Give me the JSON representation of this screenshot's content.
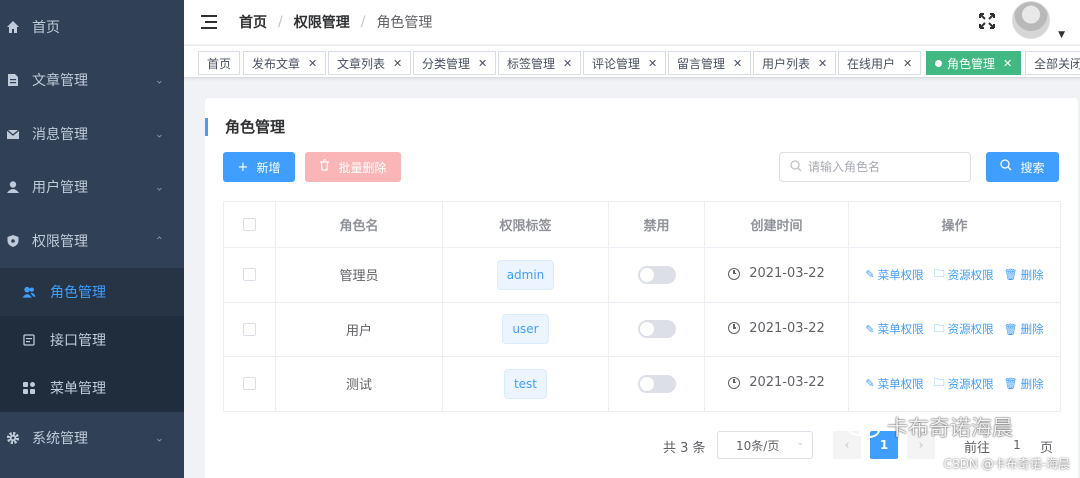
{
  "sidebar": {
    "items": [
      {
        "label": "首页",
        "icon": "home-icon",
        "expandable": false
      },
      {
        "label": "文章管理",
        "icon": "document-icon",
        "expandable": true
      },
      {
        "label": "消息管理",
        "icon": "mail-icon",
        "expandable": true
      },
      {
        "label": "用户管理",
        "icon": "user-icon",
        "expandable": true
      },
      {
        "label": "权限管理",
        "icon": "shield-icon",
        "expandable": true,
        "expanded": true
      },
      {
        "label": "系统管理",
        "icon": "gear-icon",
        "expandable": true
      }
    ],
    "submenu": [
      {
        "label": "角色管理",
        "icon": "users-icon",
        "active": true
      },
      {
        "label": "接口管理",
        "icon": "api-icon",
        "active": false
      },
      {
        "label": "菜单管理",
        "icon": "grid-icon",
        "active": false
      }
    ]
  },
  "header": {
    "breadcrumb": [
      "首页",
      "权限管理",
      "角色管理"
    ]
  },
  "tags": [
    {
      "label": "首页",
      "closable": false
    },
    {
      "label": "发布文章",
      "closable": true
    },
    {
      "label": "文章列表",
      "closable": true
    },
    {
      "label": "分类管理",
      "closable": true
    },
    {
      "label": "标签管理",
      "closable": true
    },
    {
      "label": "评论管理",
      "closable": true
    },
    {
      "label": "留言管理",
      "closable": true
    },
    {
      "label": "用户列表",
      "closable": true
    },
    {
      "label": "在线用户",
      "closable": true
    },
    {
      "label": "角色管理",
      "closable": true,
      "active": true
    },
    {
      "label": "全部关闭",
      "closable": false
    }
  ],
  "card": {
    "title": "角色管理",
    "add_label": "新增",
    "batch_delete_label": "批量删除",
    "search_placeholder": "请输入角色名",
    "search_label": "搜索"
  },
  "table": {
    "columns": [
      "角色名",
      "权限标签",
      "禁用",
      "创建时间",
      "操作"
    ],
    "rows": [
      {
        "name": "管理员",
        "tag": "admin",
        "disabled": false,
        "created": "2021-03-22"
      },
      {
        "name": "用户",
        "tag": "user",
        "disabled": false,
        "created": "2021-03-22"
      },
      {
        "name": "测试",
        "tag": "test",
        "disabled": false,
        "created": "2021-03-22"
      }
    ],
    "actions": [
      "菜单权限",
      "资源权限",
      "删除"
    ]
  },
  "pagination": {
    "total_label": "共 3 条",
    "page_size": "10条/页",
    "current_page": "1",
    "goto_label": "前往",
    "goto_value": "1",
    "page_unit": "页"
  },
  "watermark": {
    "main": "卡布奇诺海晨",
    "sub": "CSDN @卡布奇诺-海晨"
  },
  "colors": {
    "sidebar_bg": "#304156",
    "primary": "#409eff",
    "active_tag": "#42b983",
    "danger_light": "#fab6b6"
  }
}
